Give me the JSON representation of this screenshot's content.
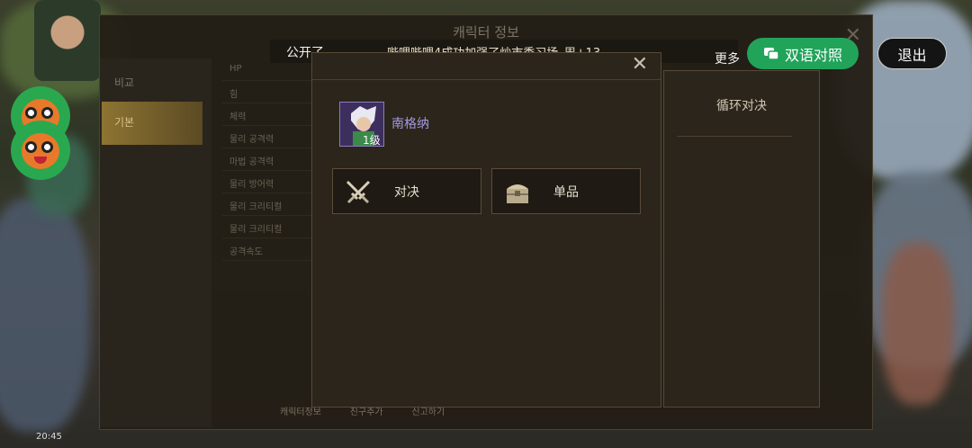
{
  "background": {
    "window_title": "캐릭터 정보",
    "tabs": [
      "비교",
      "기본"
    ],
    "stat_rows": [
      "HP",
      "힘",
      "체력",
      "물리 공격력",
      "마법 공격력",
      "물리 방어력",
      "물리 크리티컬",
      "물리 크리티컬",
      "공격속도"
    ],
    "bottom_links": [
      "캐릭터정보",
      "친구추가",
      "신고하기"
    ],
    "clock": "20:45"
  },
  "announcement": {
    "label": "公开了。",
    "text": "哔哩哔哩4成功加强了炒市委习场–周+13。"
  },
  "toolbar": {
    "more": "更多",
    "bilingual": "双语对照",
    "exit": "退出"
  },
  "dialog": {
    "title": "",
    "character": {
      "name": "南格纳",
      "level": "1级"
    },
    "buttons": [
      {
        "label": "对决",
        "icon": "crossed-swords-icon"
      },
      {
        "label": "单品",
        "icon": "treasure-chest-icon"
      }
    ]
  },
  "side_panel": {
    "item": "循环对决"
  },
  "colors": {
    "accent_green": "#21a35a",
    "character_name": "#a59ae0",
    "panel_bg": "#2b251c",
    "panel_border": "#564a35"
  }
}
